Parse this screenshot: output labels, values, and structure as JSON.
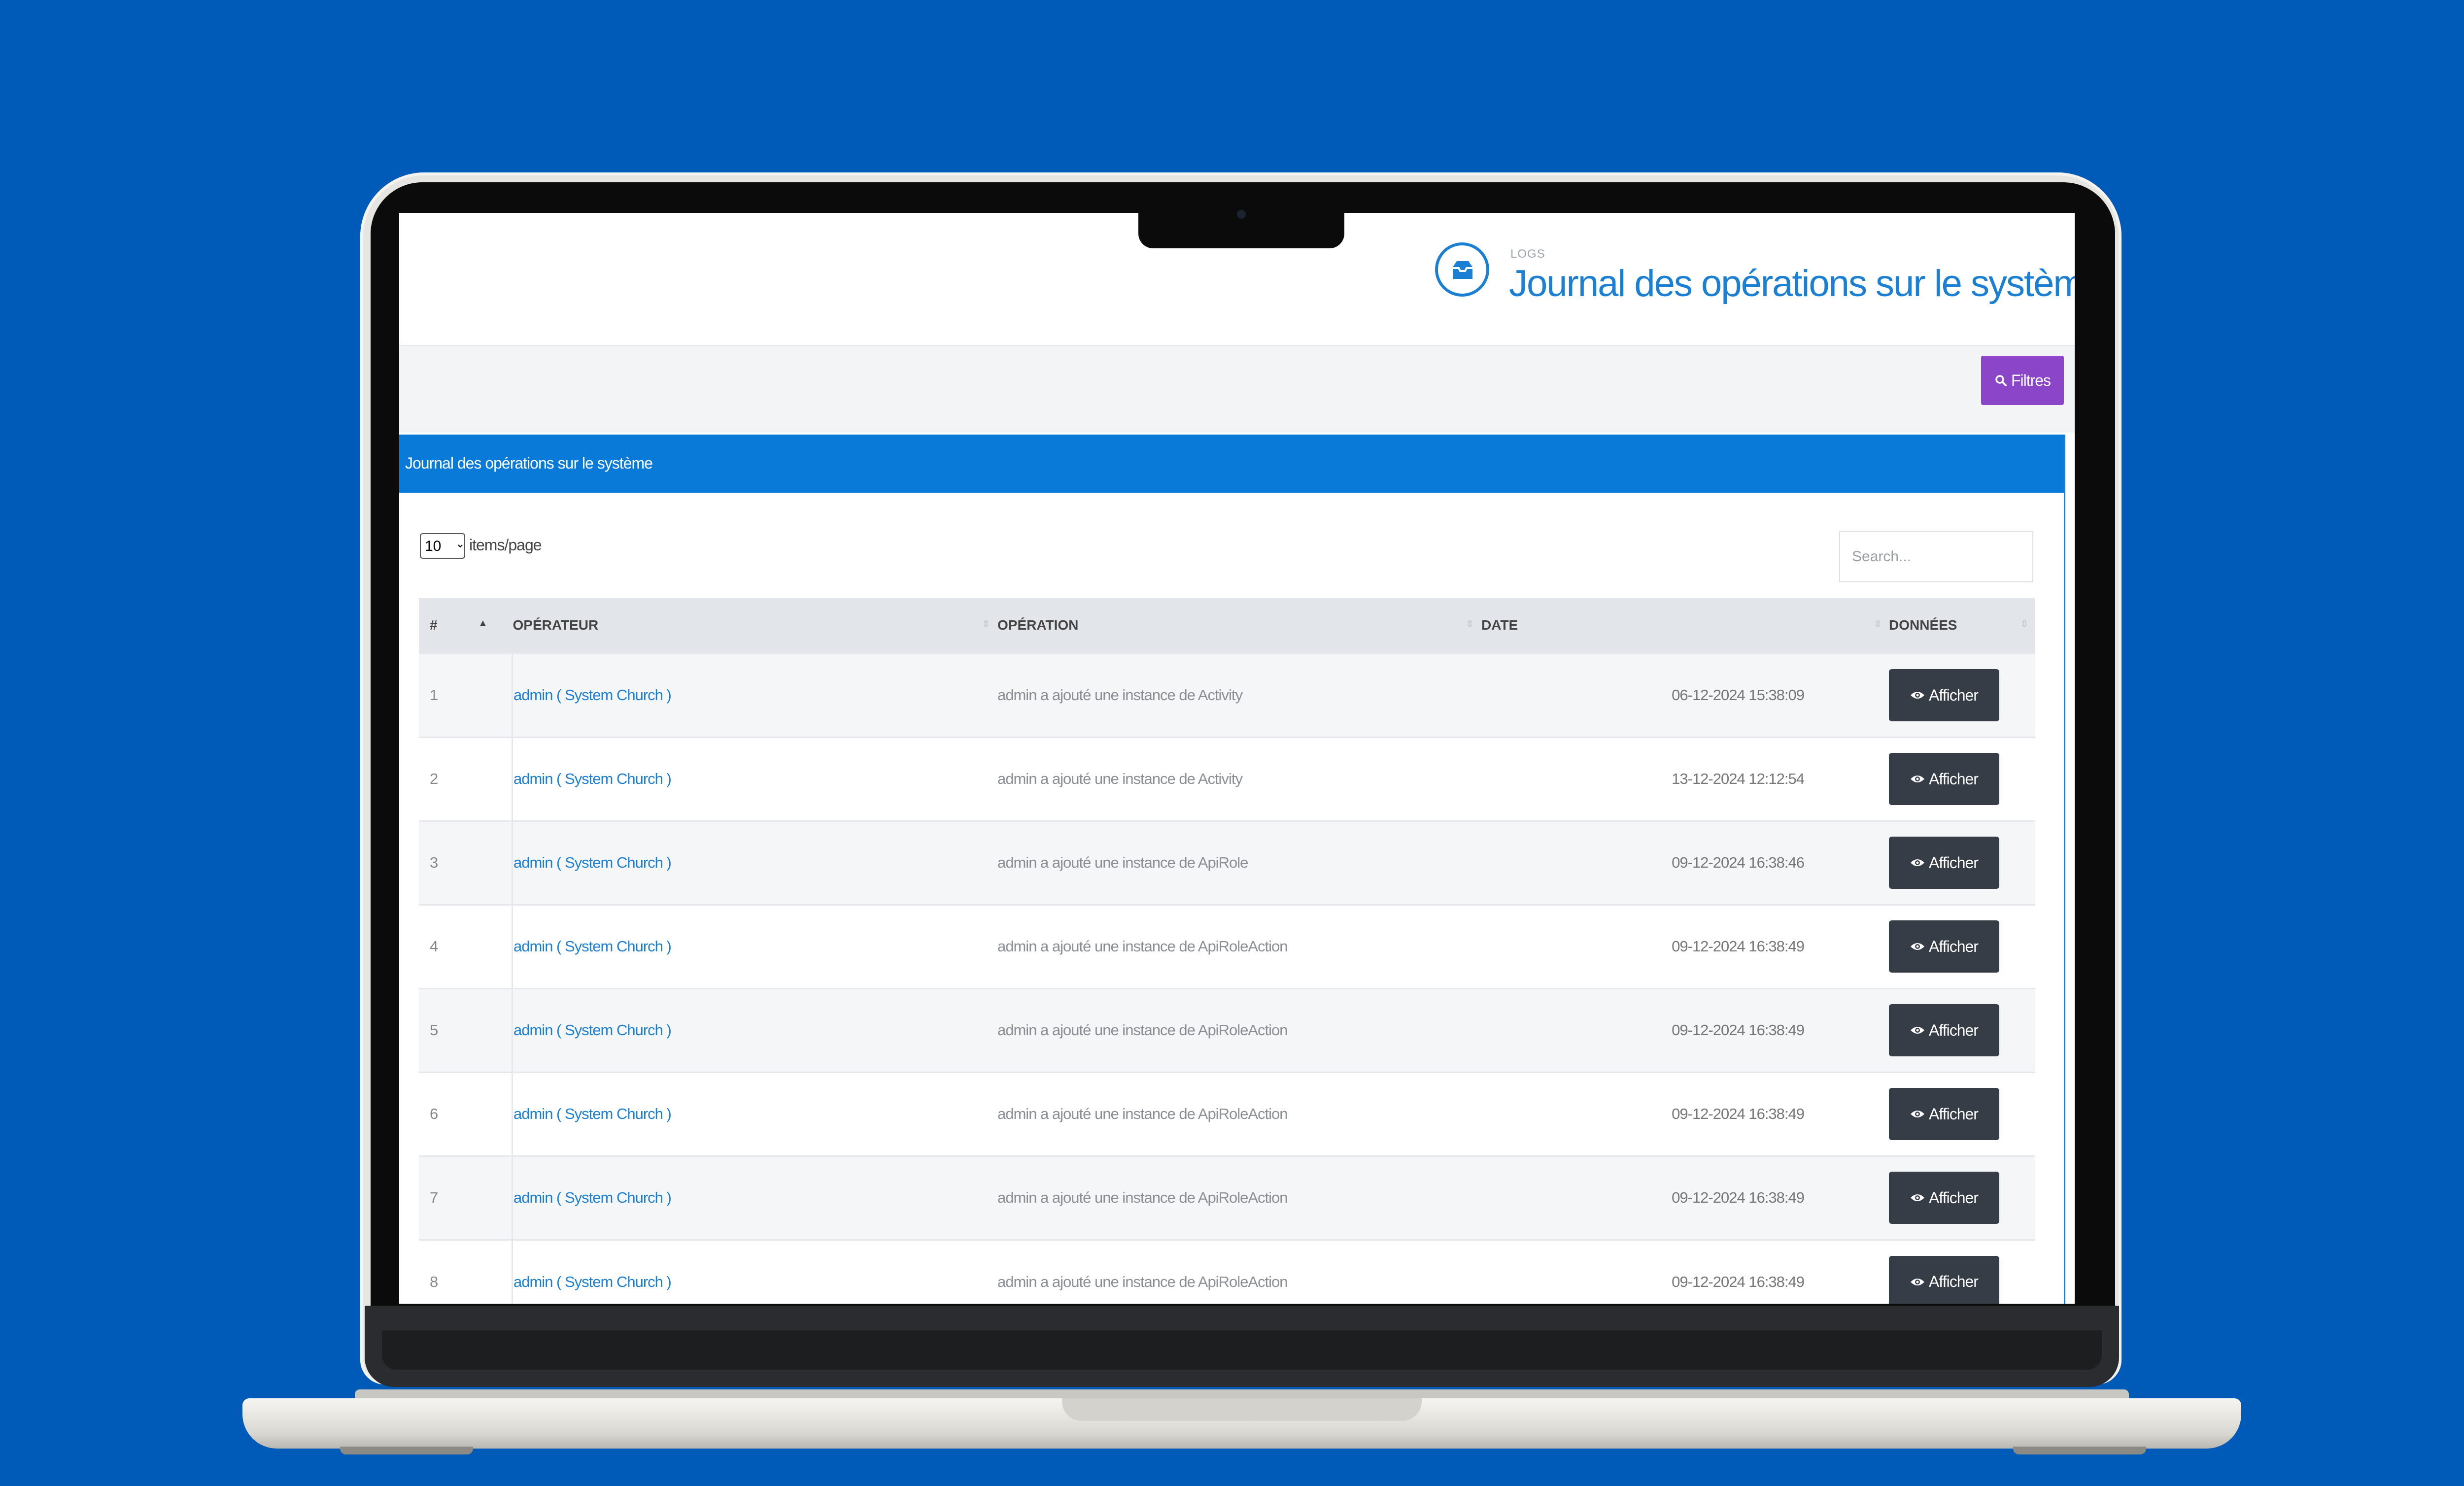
{
  "header": {
    "section_label": "LOGS",
    "title": "Journal des opérations sur le système"
  },
  "toolbar": {
    "filter_label": "Filtres"
  },
  "panel": {
    "title": "Journal des opérations sur le système",
    "length_value": "10",
    "length_label": "items/page",
    "search_placeholder": "Search..."
  },
  "table": {
    "columns": [
      "#",
      "OPÉRATEUR",
      "OPÉRATION",
      "DATE",
      "DONNÉES"
    ],
    "action_label": "Afficher",
    "rows": [
      {
        "num": "1",
        "operator": "admin ( System Church )",
        "operation": "admin a ajouté une instance de Activity",
        "date": "06-12-2024 15:38:09"
      },
      {
        "num": "2",
        "operator": "admin ( System Church )",
        "operation": "admin a ajouté une instance de Activity",
        "date": "13-12-2024 12:12:54"
      },
      {
        "num": "3",
        "operator": "admin ( System Church )",
        "operation": "admin a ajouté une instance de ApiRole",
        "date": "09-12-2024 16:38:46"
      },
      {
        "num": "4",
        "operator": "admin ( System Church )",
        "operation": "admin a ajouté une instance de ApiRoleAction",
        "date": "09-12-2024 16:38:49"
      },
      {
        "num": "5",
        "operator": "admin ( System Church )",
        "operation": "admin a ajouté une instance de ApiRoleAction",
        "date": "09-12-2024 16:38:49"
      },
      {
        "num": "6",
        "operator": "admin ( System Church )",
        "operation": "admin a ajouté une instance de ApiRoleAction",
        "date": "09-12-2024 16:38:49"
      },
      {
        "num": "7",
        "operator": "admin ( System Church )",
        "operation": "admin a ajouté une instance de ApiRoleAction",
        "date": "09-12-2024 16:38:49"
      },
      {
        "num": "8",
        "operator": "admin ( System Church )",
        "operation": "admin a ajouté une instance de ApiRoleAction",
        "date": "09-12-2024 16:38:49"
      }
    ]
  },
  "colors": {
    "background": "#005bb8",
    "accent": "#1b7fd4",
    "panel_header": "#0a7ad8",
    "filter_button": "#8b45c8",
    "action_button": "#363d46"
  },
  "icons": {
    "header": "inbox-icon",
    "filter": "search-icon",
    "action": "eye-icon"
  }
}
